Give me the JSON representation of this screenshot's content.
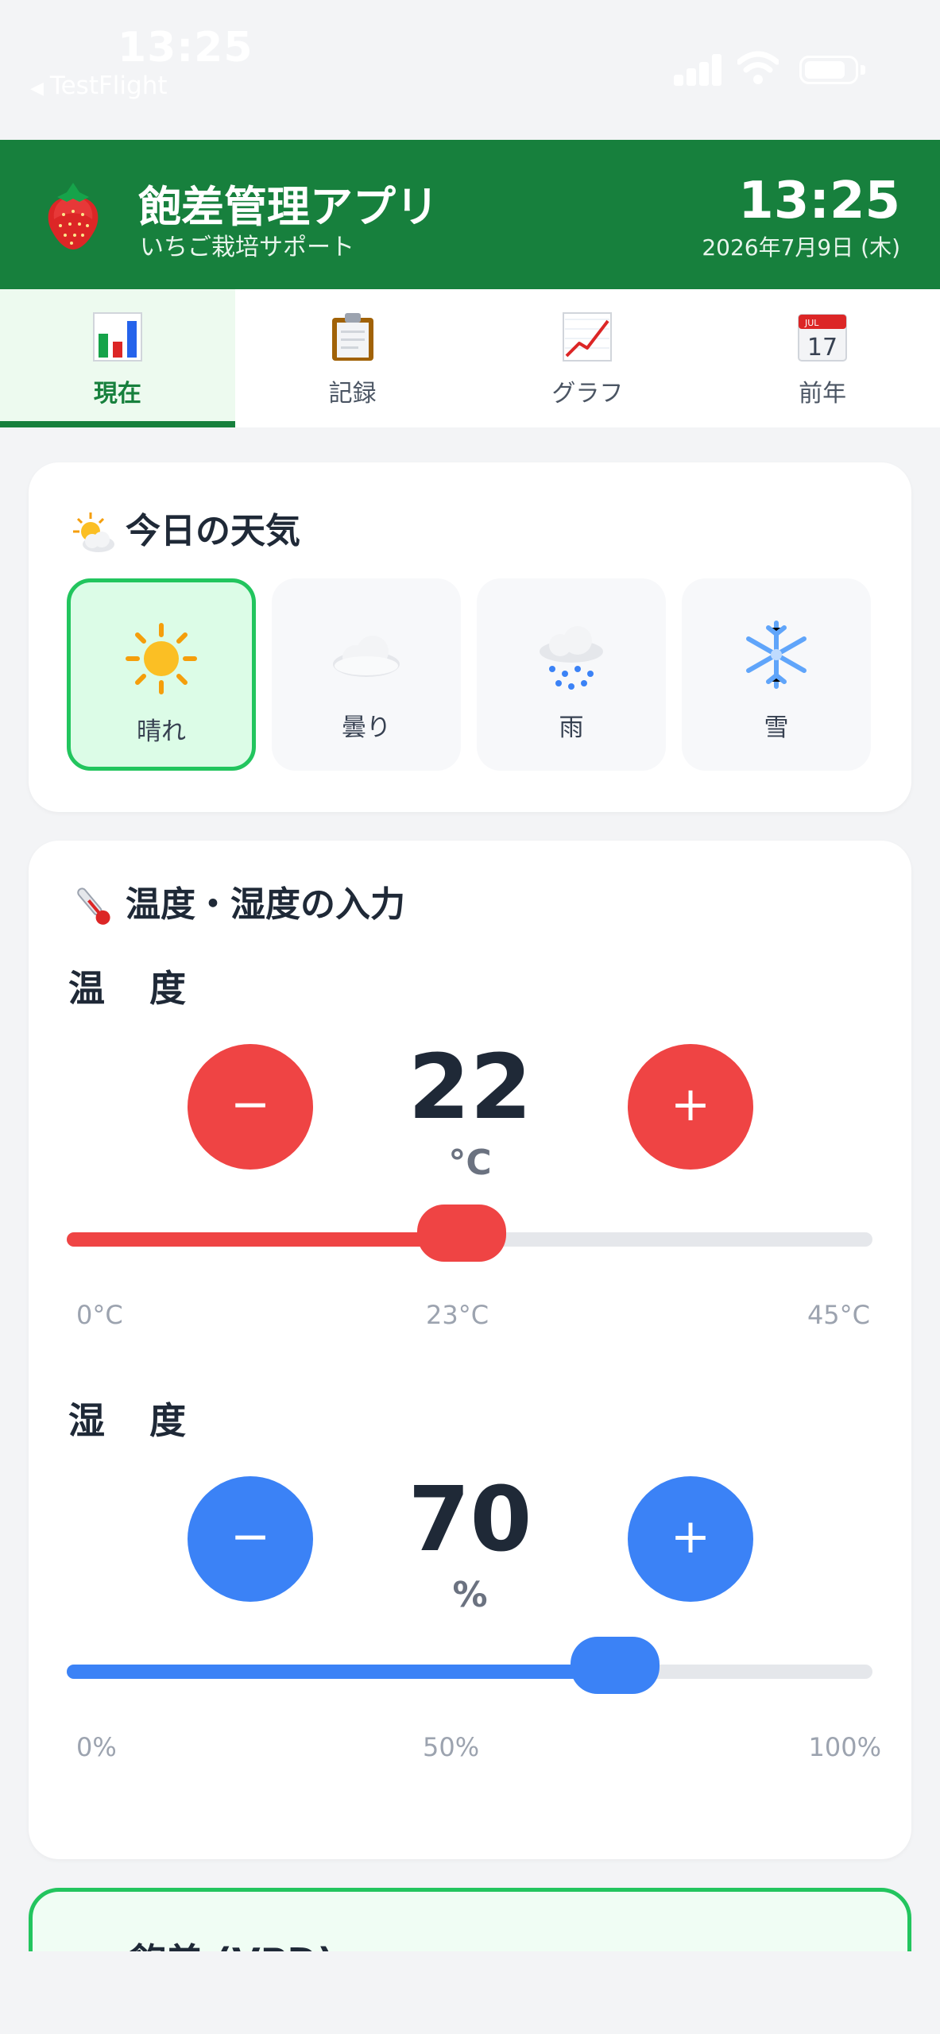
{
  "status_bar": {
    "time": "13:25",
    "back_label": "TestFlight"
  },
  "header": {
    "title": "飽差管理アプリ",
    "subtitle": "いちご栽培サポート",
    "clock": "13:25",
    "date": "2026年7月9日 (木)"
  },
  "tabs": [
    {
      "label": "現在",
      "icon": "bar-chart-icon",
      "active": true
    },
    {
      "label": "記録",
      "icon": "clipboard-icon",
      "active": false
    },
    {
      "label": "グラフ",
      "icon": "line-chart-icon",
      "active": false
    },
    {
      "label": "前年",
      "icon": "calendar-icon",
      "active": false
    }
  ],
  "weather": {
    "title": "今日の天気",
    "title_icon": "sun-behind-cloud-icon",
    "options": [
      {
        "label": "晴れ",
        "icon": "sun-icon",
        "selected": true
      },
      {
        "label": "曇り",
        "icon": "cloud-icon",
        "selected": false
      },
      {
        "label": "雨",
        "icon": "rain-cloud-icon",
        "selected": false
      },
      {
        "label": "雪",
        "icon": "snowflake-icon",
        "selected": false
      }
    ]
  },
  "input": {
    "title": "温度・湿度の入力",
    "title_icon": "thermometer-icon",
    "temperature": {
      "label": "温 度",
      "value": "22",
      "unit": "°C",
      "min_label": "0°C",
      "mid_label": "23°C",
      "max_label": "45°C",
      "slider_fraction": 0.49,
      "color": "#ef4444",
      "minus": "−",
      "plus": "+"
    },
    "humidity": {
      "label": "湿 度",
      "value": "70",
      "unit": "%",
      "min_label": "0%",
      "mid_label": "50%",
      "max_label": "100%",
      "slider_fraction": 0.68,
      "color": "#3b82f6",
      "minus": "−",
      "plus": "+"
    }
  },
  "vpd": {
    "title": "飽差 (VPD)",
    "icon": "steam-icon"
  },
  "colors": {
    "header_green": "#17803d",
    "accent_green": "#22c55e"
  }
}
